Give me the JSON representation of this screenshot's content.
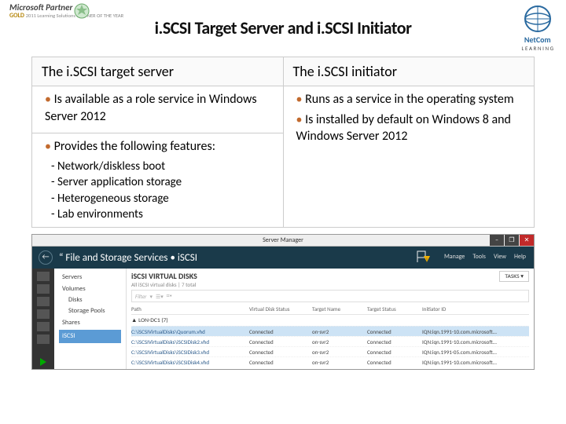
{
  "header": {
    "partner_brand": "Microsoft Partner",
    "partner_gold": "GOLD",
    "partner_sub": "2011 Learning Solutions\nPARTNER OF THE YEAR",
    "title": "i.SCSI Target Server and i.SCSI Initiator",
    "netcom_brand": "NetCom",
    "netcom_tag": "L E A R N I N G"
  },
  "table": {
    "left_head": "The i.SCSI target server",
    "right_head": "The i.SCSI initiator",
    "left_items": [
      "Is available as a role service in Windows Server 2012",
      "Provides the following features:"
    ],
    "left_sub": [
      "Network/diskless boot",
      "Server application storage",
      "Heterogeneous storage",
      "Lab environments"
    ],
    "right_items": [
      "Runs as a service in the operating system",
      "Is installed by default on Windows 8 and Windows Server 2012"
    ]
  },
  "server_manager": {
    "window_title": "Server Manager",
    "breadcrumb": "“ File and Storage Services • iSCSI",
    "menu": {
      "manage": "Manage",
      "tools": "Tools",
      "view": "View",
      "help": "Help"
    },
    "nav": {
      "servers": "Servers",
      "volumes": "Volumes",
      "disks": "Disks",
      "storage_pools": "Storage Pools",
      "shares": "Shares",
      "iscsi": "iSCSI"
    },
    "section_title": "iSCSI VIRTUAL DISKS",
    "section_sub": "All iSCSI virtual disks | 7 total",
    "tasks_label": "TASKS ▾",
    "filter_placeholder": "Filter",
    "columns": {
      "c1": "Path",
      "c2": "Virtual Disk Status",
      "c3": "Target Name",
      "c4": "Target Status",
      "c5": "Initiator ID"
    },
    "group": "▲ LON-DC1 (7)",
    "rows": [
      {
        "path": "C:\\iSCSIVirtualDisks\\Quorum.vhd",
        "vstatus": "Connected",
        "tname": "on-svr2",
        "tstatus": "Connected",
        "iid": "IQN:iqn.1991-10.com.microsoft..."
      },
      {
        "path": "C:\\iSCSIVirtualDisks\\iSCSIDisk2.vhd",
        "vstatus": "Connected",
        "tname": "on-svr2",
        "tstatus": "Connected",
        "iid": "IQN:iqn.1991-10.com.microsoft..."
      },
      {
        "path": "C:\\iSCSIVirtualDisks\\iSCSIDisk3.vhd",
        "vstatus": "Connected",
        "tname": "on-svr2",
        "tstatus": "Connected",
        "iid": "IQN:iqn.1991-05.com.microsoft..."
      },
      {
        "path": "C:\\iSCSIVirtualDisks\\iSCSIDisk4.vhd",
        "vstatus": "Connected",
        "tname": "on-svr2",
        "tstatus": "Connected",
        "iid": "IQN:iqn.1991-10.com.microsoft..."
      }
    ]
  }
}
